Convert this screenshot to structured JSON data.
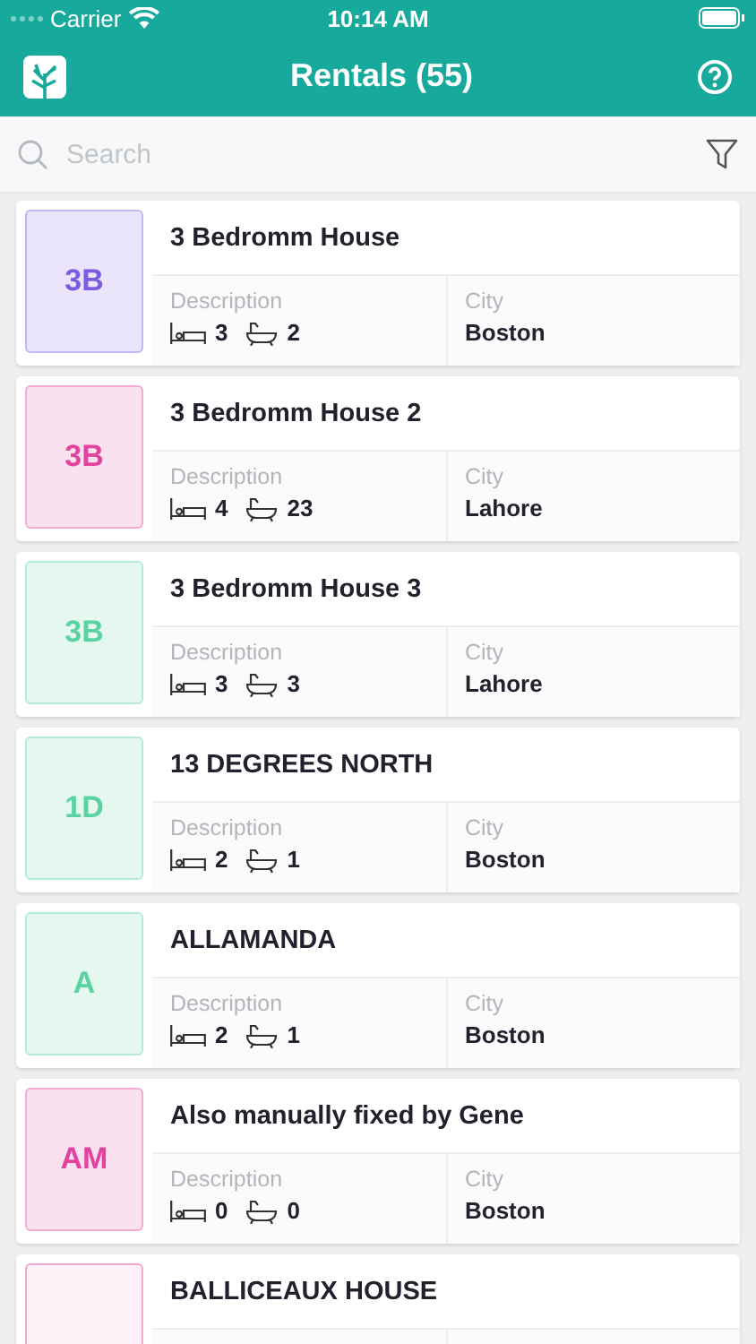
{
  "status_bar": {
    "carrier": "Carrier",
    "time": "10:14 AM"
  },
  "header": {
    "title": "Rentals (55)"
  },
  "search": {
    "placeholder": "Search"
  },
  "rentals": [
    {
      "initials": "3B",
      "color": "#7b5ce0",
      "title": "3 Bedromm House",
      "description_label": "Description",
      "beds": "3",
      "baths": "2",
      "city_label": "City",
      "city": "Boston"
    },
    {
      "initials": "3B",
      "color": "#e2439e",
      "title": "3 Bedromm House 2",
      "description_label": "Description",
      "beds": "4",
      "baths": "23",
      "city_label": "City",
      "city": "Lahore"
    },
    {
      "initials": "3B",
      "color": "#5ad3a4",
      "title": "3 Bedromm House 3",
      "description_label": "Description",
      "beds": "3",
      "baths": "3",
      "city_label": "City",
      "city": "Lahore"
    },
    {
      "initials": "1D",
      "color": "#5ad3a4",
      "title": "13 DEGREES NORTH",
      "description_label": "Description",
      "beds": "2",
      "baths": "1",
      "city_label": "City",
      "city": "Boston"
    },
    {
      "initials": "A",
      "color": "#5ad3a4",
      "title": "ALLAMANDA",
      "description_label": "Description",
      "beds": "2",
      "baths": "1",
      "city_label": "City",
      "city": "Boston"
    },
    {
      "initials": "AM",
      "color": "#e2439e",
      "title": "Also manually fixed by Gene",
      "description_label": "Description",
      "beds": "0",
      "baths": "0",
      "city_label": "City",
      "city": "Boston"
    },
    {
      "color": "#f2a6d0",
      "title": "BALLICEAUX HOUSE"
    }
  ]
}
